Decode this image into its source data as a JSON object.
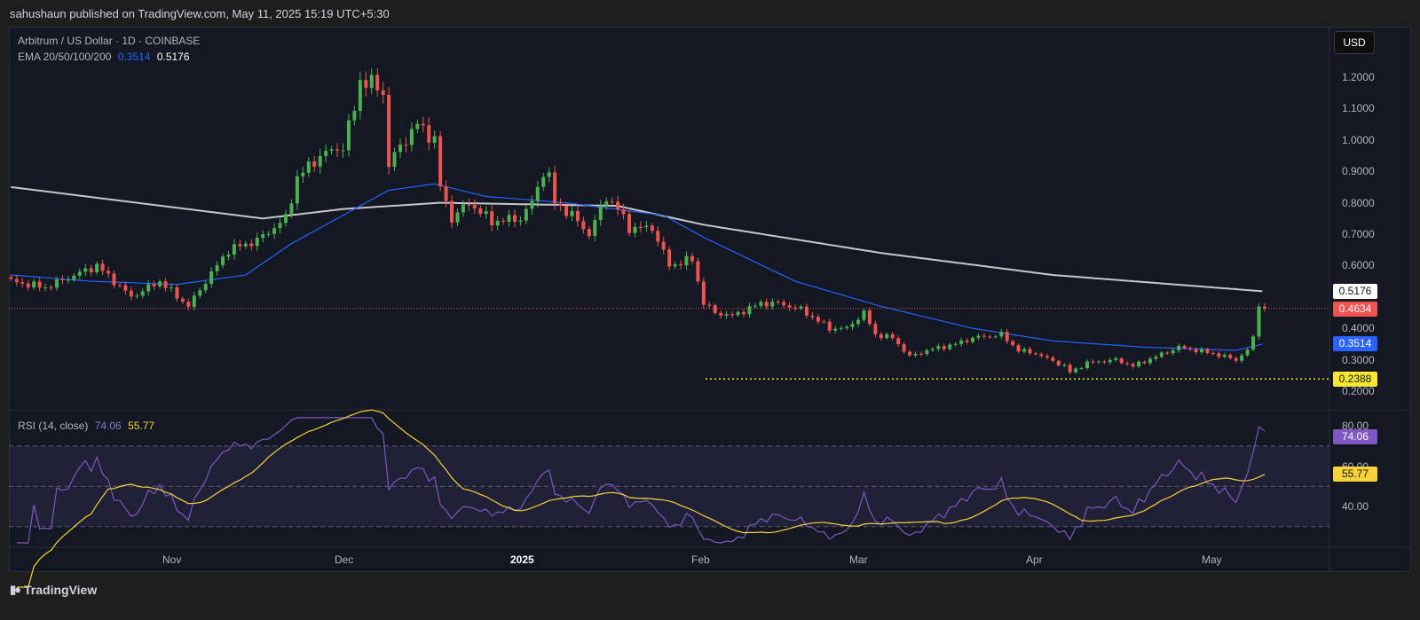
{
  "header": {
    "published": "sahushaun published on TradingView.com, May 11, 2025 15:19 UTC+5:30"
  },
  "legend": {
    "symbol": "Arbitrum / US Dollar · 1D · COINBASE",
    "ema_label": "EMA 20/50/100/200",
    "ema50": "0.3514",
    "ema200": "0.5176",
    "rsi_label": "RSI (14, close)",
    "rsi_value": "74.06",
    "rsi_ma_value": "55.77"
  },
  "price_axis": {
    "currency": "USD",
    "ticks": [
      "1.2000",
      "1.1000",
      "1.0000",
      "0.9000",
      "0.8000",
      "0.7000",
      "0.6000",
      "0.4000",
      "0.3000",
      "0.2000"
    ]
  },
  "tags": {
    "ema200": "0.5176",
    "last_price": "0.4634",
    "ema50": "0.3514",
    "support": "0.2388",
    "rsi": "74.06",
    "rsi_ma": "55.77"
  },
  "rsi_axis": {
    "ticks": [
      "80.00",
      "60.00",
      "40.00"
    ]
  },
  "time_axis": [
    "Nov",
    "Dec",
    "2025",
    "Feb",
    "Mar",
    "Apr",
    "May"
  ],
  "footer": {
    "brand": "TradingView"
  },
  "colors": {
    "up": "#4caf50",
    "down": "#ef5350",
    "ema50": "#2962ff",
    "ema200": "#c8c8c8",
    "rsi": "#7e57c2",
    "rsi_ma": "#f7d23a",
    "support": "#f7e733"
  },
  "chart_data": {
    "type": "candlestick",
    "title": "Arbitrum / US Dollar · 1D · COINBASE",
    "ylim": [
      0.2,
      1.25
    ],
    "rsi_ylim": [
      20,
      85
    ],
    "support_level": 0.2388,
    "last_price": 0.4634,
    "close_keypoints": [
      [
        "2024-10-04",
        0.55
      ],
      [
        "2024-10-10",
        0.53
      ],
      [
        "2024-10-19",
        0.6
      ],
      [
        "2024-10-25",
        0.5
      ],
      [
        "2024-10-30",
        0.55
      ],
      [
        "2024-11-04",
        0.47
      ],
      [
        "2024-11-07",
        0.55
      ],
      [
        "2024-11-11",
        0.65
      ],
      [
        "2024-11-16",
        0.68
      ],
      [
        "2024-11-21",
        0.75
      ],
      [
        "2024-11-23",
        0.88
      ],
      [
        "2024-11-27",
        0.95
      ],
      [
        "2024-12-01",
        0.98
      ],
      [
        "2024-12-03",
        1.1
      ],
      [
        "2024-12-04",
        1.19
      ],
      [
        "2024-12-06",
        1.18
      ],
      [
        "2024-12-08",
        1.15
      ],
      [
        "2024-12-09",
        0.92
      ],
      [
        "2024-12-11",
        0.98
      ],
      [
        "2024-12-14",
        1.05
      ],
      [
        "2024-12-17",
        1.0
      ],
      [
        "2024-12-18",
        0.85
      ],
      [
        "2024-12-20",
        0.75
      ],
      [
        "2024-12-23",
        0.8
      ],
      [
        "2024-12-27",
        0.74
      ],
      [
        "2025-01-01",
        0.75
      ],
      [
        "2025-01-03",
        0.8
      ],
      [
        "2025-01-05",
        0.9
      ],
      [
        "2025-01-06",
        0.88
      ],
      [
        "2025-01-07",
        0.8
      ],
      [
        "2025-01-10",
        0.76
      ],
      [
        "2025-01-13",
        0.7
      ],
      [
        "2025-01-16",
        0.82
      ],
      [
        "2025-01-18",
        0.78
      ],
      [
        "2025-01-20",
        0.72
      ],
      [
        "2025-01-24",
        0.72
      ],
      [
        "2025-01-27",
        0.6
      ],
      [
        "2025-01-31",
        0.62
      ],
      [
        "2025-02-02",
        0.48
      ],
      [
        "2025-02-04",
        0.45
      ],
      [
        "2025-02-07",
        0.44
      ],
      [
        "2025-02-12",
        0.48
      ],
      [
        "2025-02-15",
        0.48
      ],
      [
        "2025-02-19",
        0.46
      ],
      [
        "2025-02-24",
        0.4
      ],
      [
        "2025-02-27",
        0.4
      ],
      [
        "2025-03-02",
        0.45
      ],
      [
        "2025-03-04",
        0.38
      ],
      [
        "2025-03-07",
        0.37
      ],
      [
        "2025-03-10",
        0.31
      ],
      [
        "2025-03-13",
        0.33
      ],
      [
        "2025-03-18",
        0.35
      ],
      [
        "2025-03-21",
        0.37
      ],
      [
        "2025-03-26",
        0.38
      ],
      [
        "2025-03-29",
        0.33
      ],
      [
        "2025-04-01",
        0.32
      ],
      [
        "2025-04-06",
        0.28
      ],
      [
        "2025-04-07",
        0.26
      ],
      [
        "2025-04-10",
        0.29
      ],
      [
        "2025-04-15",
        0.3
      ],
      [
        "2025-04-18",
        0.28
      ],
      [
        "2025-04-22",
        0.31
      ],
      [
        "2025-04-26",
        0.34
      ],
      [
        "2025-05-02",
        0.32
      ],
      [
        "2025-05-06",
        0.3
      ],
      [
        "2025-05-08",
        0.33
      ],
      [
        "2025-05-09",
        0.37
      ],
      [
        "2025-05-10",
        0.48
      ],
      [
        "2025-05-11",
        0.4634
      ]
    ],
    "ema200_keypoints": [
      [
        "2024-10-04",
        0.85
      ],
      [
        "2024-11-17",
        0.75
      ],
      [
        "2024-12-01",
        0.78
      ],
      [
        "2024-12-18",
        0.8
      ],
      [
        "2025-01-18",
        0.79
      ],
      [
        "2025-02-02",
        0.73
      ],
      [
        "2025-03-05",
        0.64
      ],
      [
        "2025-04-04",
        0.57
      ],
      [
        "2025-05-11",
        0.5176
      ]
    ],
    "ema50_keypoints": [
      [
        "2024-10-04",
        0.57
      ],
      [
        "2024-10-18",
        0.55
      ],
      [
        "2024-11-02",
        0.54
      ],
      [
        "2024-11-14",
        0.57
      ],
      [
        "2024-11-22",
        0.67
      ],
      [
        "2024-12-03",
        0.78
      ],
      [
        "2024-12-09",
        0.84
      ],
      [
        "2024-12-17",
        0.86
      ],
      [
        "2024-12-26",
        0.82
      ],
      [
        "2025-01-09",
        0.8
      ],
      [
        "2025-01-26",
        0.76
      ],
      [
        "2025-02-02",
        0.69
      ],
      [
        "2025-02-18",
        0.55
      ],
      [
        "2025-03-05",
        0.47
      ],
      [
        "2025-03-21",
        0.4
      ],
      [
        "2025-04-04",
        0.36
      ],
      [
        "2025-04-20",
        0.34
      ],
      [
        "2025-05-06",
        0.33
      ],
      [
        "2025-05-11",
        0.3514
      ]
    ]
  }
}
